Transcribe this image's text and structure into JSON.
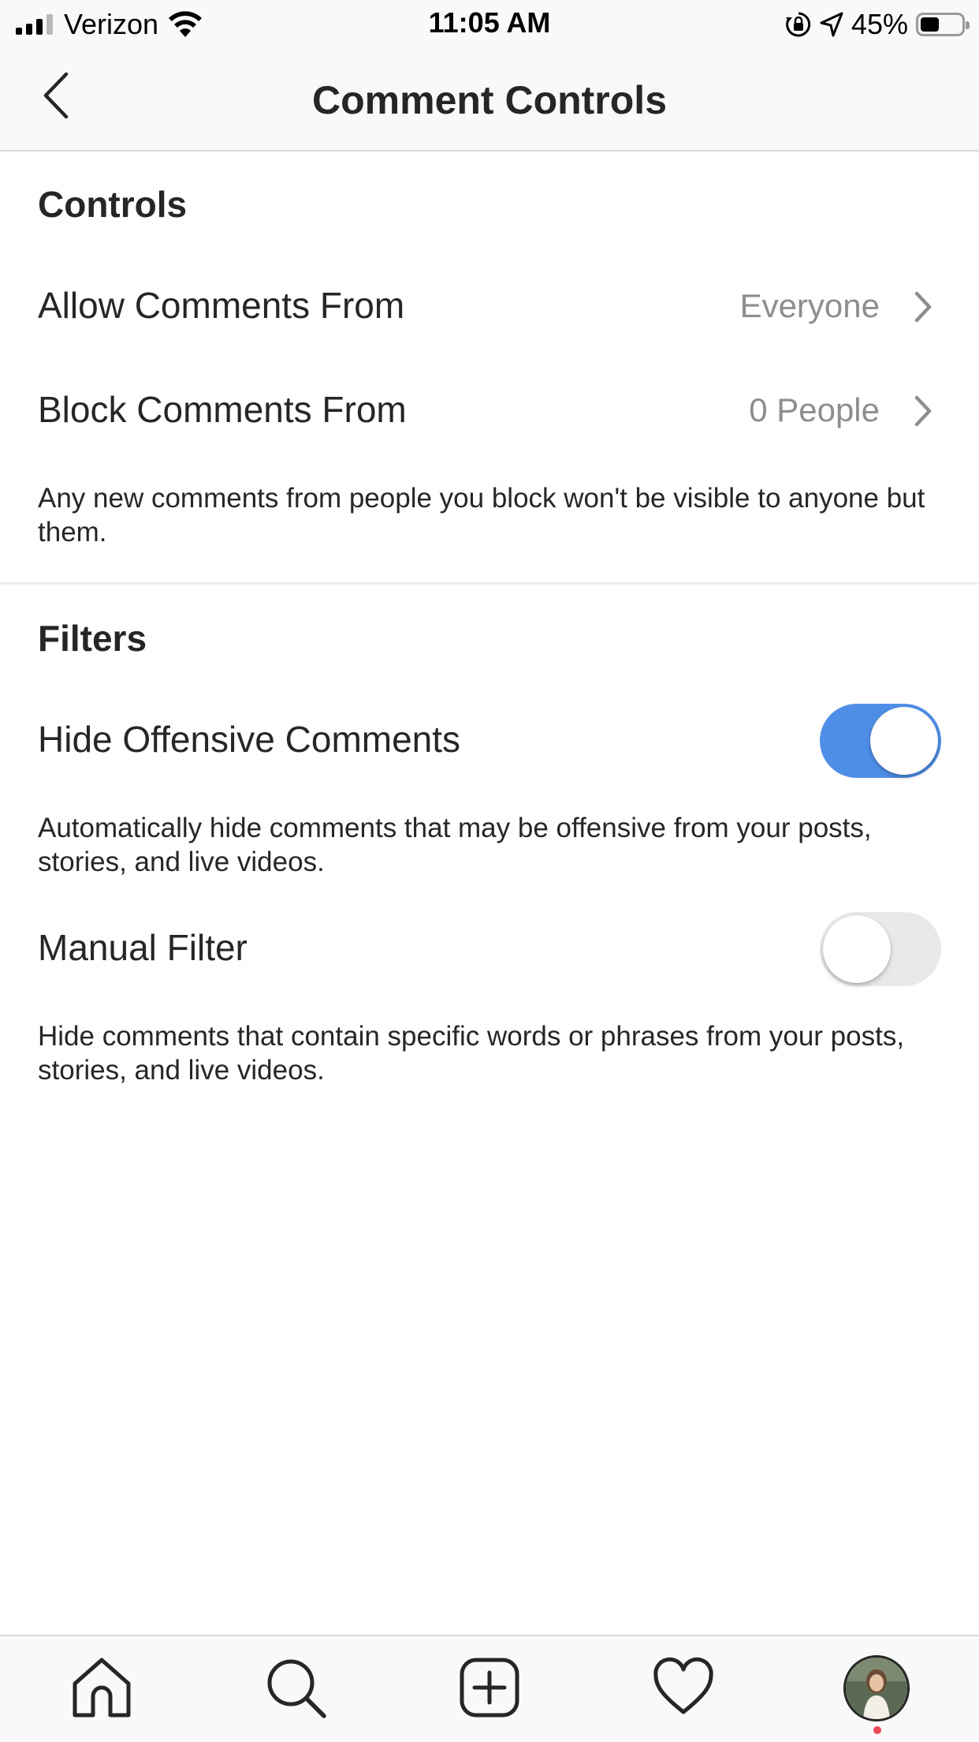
{
  "status_bar": {
    "carrier": "Verizon",
    "time": "11:05 AM",
    "battery_percent": "45%",
    "battery_level": 0.45
  },
  "header": {
    "title": "Comment Controls",
    "back_icon": "chevron-left-icon"
  },
  "controls": {
    "section_title": "Controls",
    "allow_comments": {
      "label": "Allow Comments From",
      "value": "Everyone"
    },
    "block_comments": {
      "label": "Block Comments From",
      "value": "0 People"
    },
    "description": "Any new comments from people you block won't be visible to anyone but them."
  },
  "filters": {
    "section_title": "Filters",
    "hide_offensive": {
      "label": "Hide Offensive Comments",
      "enabled": true,
      "description": "Automatically hide comments that may be offensive from your posts, stories, and live videos."
    },
    "manual_filter": {
      "label": "Manual Filter",
      "enabled": false,
      "description": "Hide comments that contain specific words or phrases from your posts, stories, and live videos."
    }
  },
  "tab_bar": {
    "items": [
      "home-icon",
      "search-icon",
      "new-post-icon",
      "activity-heart-icon",
      "profile-avatar"
    ]
  },
  "colors": {
    "toggle_on": "#4f8ee6",
    "toggle_off": "#e9e9ea",
    "secondary_text": "#8e8e8e",
    "notification_dot": "#ed4956"
  }
}
